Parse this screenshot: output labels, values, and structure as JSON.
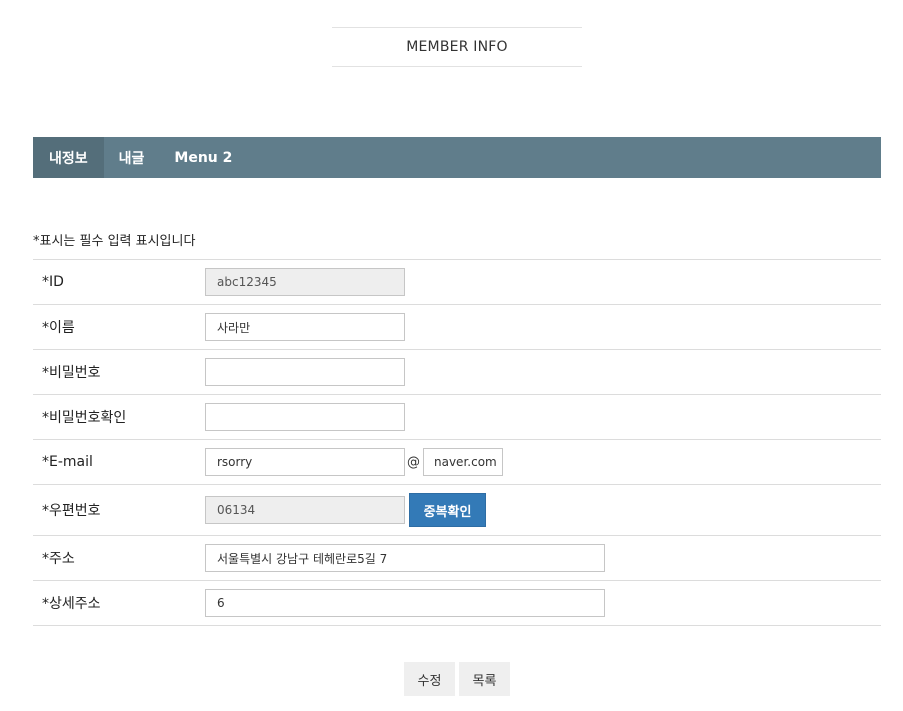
{
  "header": {
    "title": "MEMBER INFO"
  },
  "tabs": [
    {
      "label": "내정보",
      "active": true
    },
    {
      "label": "내글",
      "active": false
    },
    {
      "label": "Menu 2",
      "active": false
    }
  ],
  "colors": {
    "tabbar": "#607d8b",
    "tab_active": "#546e7a",
    "primary_button": "#337ab7"
  },
  "notice": "*표시는 필수 입력 표시입니다",
  "form": {
    "id": {
      "label": "*ID",
      "value": "abc12345"
    },
    "name": {
      "label": "*이름",
      "value": "사라만"
    },
    "password": {
      "label": "*비밀번호",
      "value": ""
    },
    "password_confirm": {
      "label": "*비밀번호확인",
      "value": ""
    },
    "email": {
      "label": "*E-mail",
      "user": "rsorry",
      "at": "@",
      "domain": "naver.com"
    },
    "zipcode": {
      "label": "*우편번호",
      "value": "06134",
      "button": "중복확인"
    },
    "address": {
      "label": "*주소",
      "value": "서울특별시 강남구 테헤란로5길 7"
    },
    "address_detail": {
      "label": "*상세주소",
      "value": "6"
    }
  },
  "actions": {
    "edit": "수정",
    "list": "목록"
  }
}
